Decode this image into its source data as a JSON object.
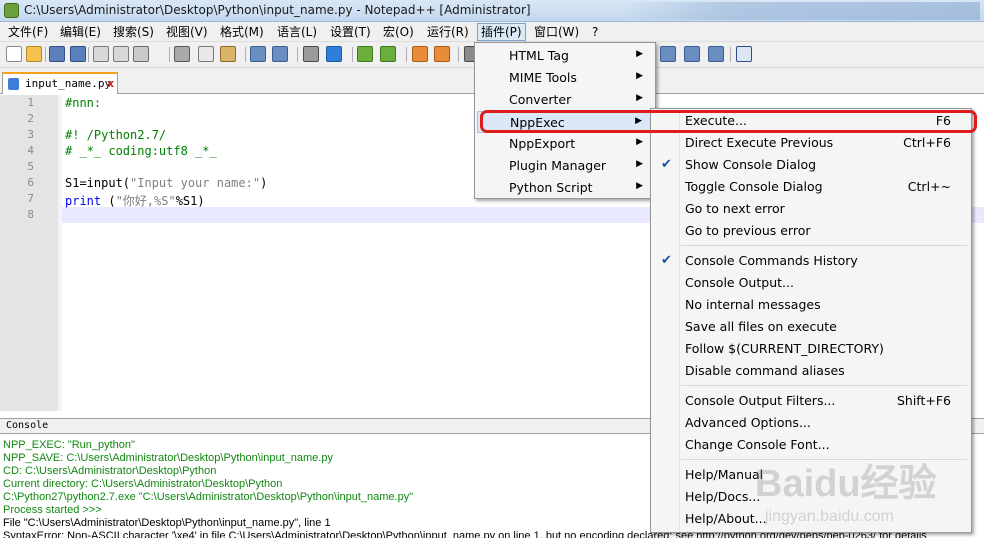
{
  "window": {
    "title": "C:\\Users\\Administrator\\Desktop\\Python\\input_name.py - Notepad++ [Administrator]"
  },
  "menubar": {
    "items": [
      "文件(F)",
      "编辑(E)",
      "搜索(S)",
      "视图(V)",
      "格式(M)",
      "语言(L)",
      "设置(T)",
      "宏(O)",
      "运行(R)",
      "插件(P)",
      "窗口(W)",
      "?"
    ],
    "active": "插件(P)"
  },
  "tab": {
    "label": "input_name.py",
    "close": "x"
  },
  "editor": {
    "line_numbers": [
      "1",
      "2",
      "3",
      "4",
      "5",
      "6",
      "7",
      "8"
    ],
    "lines": [
      {
        "parts": [
          {
            "t": "#nnn:",
            "c": "cm"
          }
        ]
      },
      {
        "parts": []
      },
      {
        "parts": [
          {
            "t": "#! /Python2.7/",
            "c": "cm"
          }
        ]
      },
      {
        "parts": [
          {
            "t": "# _*_ coding:utf8 _*_",
            "c": "cm"
          }
        ]
      },
      {
        "parts": []
      },
      {
        "parts": [
          {
            "t": "S1=input(",
            "c": ""
          },
          {
            "t": "\"Input your name:\"",
            "c": "str"
          },
          {
            "t": ")",
            "c": ""
          }
        ]
      },
      {
        "parts": [
          {
            "t": "print",
            "c": "kw"
          },
          {
            "t": " (",
            "c": ""
          },
          {
            "t": "\"你好,%S\"",
            "c": "str"
          },
          {
            "t": "%S1)",
            "c": ""
          }
        ]
      },
      {
        "parts": []
      }
    ],
    "current_line": "8"
  },
  "console": {
    "title": "Console",
    "lines": [
      {
        "text": "NPP_EXEC: \"Run_python\"",
        "color": "green"
      },
      {
        "text": "NPP_SAVE: C:\\Users\\Administrator\\Desktop\\Python\\input_name.py",
        "color": "green"
      },
      {
        "text": "CD: C:\\Users\\Administrator\\Desktop\\Python",
        "color": "green"
      },
      {
        "text": "Current directory: C:\\Users\\Administrator\\Desktop\\Python",
        "color": "green"
      },
      {
        "text": "C:\\Python27\\python2.7.exe \"C:\\Users\\Administrator\\Desktop\\Python\\input_name.py\"",
        "color": "green"
      },
      {
        "text": "Process started >>>",
        "color": "green"
      },
      {
        "text": "  File \"C:\\Users\\Administrator\\Desktop\\Python\\input_name.py\", line 1",
        "color": "black"
      },
      {
        "text": "SyntaxError: Non-ASCII character '\\xe4' in file C:\\Users\\Administrator\\Desktop\\Python\\input_name.py on line 1, but no encoding declared; see http://python.org/dev/peps/pep-0263/ for details",
        "color": "black"
      }
    ]
  },
  "plugins_menu": {
    "items": [
      {
        "label": "HTML Tag",
        "has_submenu": true
      },
      {
        "label": "MIME Tools",
        "has_submenu": true
      },
      {
        "label": "Converter",
        "has_submenu": true
      },
      {
        "label": "NppExec",
        "has_submenu": true,
        "highlighted": true
      },
      {
        "label": "NppExport",
        "has_submenu": true
      },
      {
        "label": "Plugin Manager",
        "has_submenu": true
      },
      {
        "label": "Python Script",
        "has_submenu": true
      }
    ]
  },
  "nppexec_menu": {
    "groups": [
      [
        {
          "label": "Execute...",
          "shortcut": "F6"
        },
        {
          "label": "Direct Execute Previous",
          "shortcut": "Ctrl+F6"
        },
        {
          "label": "Show Console Dialog",
          "checked": true
        },
        {
          "label": "Toggle Console Dialog",
          "shortcut": "Ctrl+~"
        },
        {
          "label": "Go to next error"
        },
        {
          "label": "Go to previous error"
        }
      ],
      [
        {
          "label": "Console Commands History",
          "checked": true
        },
        {
          "label": "Console Output..."
        },
        {
          "label": "No internal messages"
        },
        {
          "label": "Save all files on execute"
        },
        {
          "label": "Follow $(CURRENT_DIRECTORY)"
        },
        {
          "label": "Disable command aliases"
        }
      ],
      [
        {
          "label": "Console Output Filters...",
          "shortcut": "Shift+F6"
        },
        {
          "label": "Advanced Options..."
        },
        {
          "label": "Change Console Font..."
        }
      ],
      [
        {
          "label": "Help/Manual"
        },
        {
          "label": "Help/Docs..."
        },
        {
          "label": "Help/About..."
        }
      ]
    ]
  },
  "watermark": {
    "text": "Baidu经验",
    "sub": "jingyan.baidu.com"
  },
  "colors": {
    "highlight": "#e01b1b",
    "menu_hover": "#dbe8f7",
    "console_green": "#118811"
  }
}
